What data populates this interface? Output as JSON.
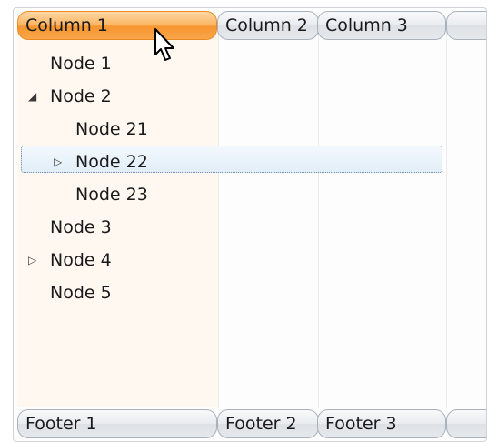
{
  "columns": [
    {
      "label": "Column 1",
      "active": true
    },
    {
      "label": "Column 2"
    },
    {
      "label": "Column 3"
    },
    {
      "label": ""
    }
  ],
  "footers": [
    {
      "label": "Footer 1"
    },
    {
      "label": "Footer 2"
    },
    {
      "label": "Footer 3"
    },
    {
      "label": ""
    }
  ],
  "tree": [
    {
      "label": "Node 1",
      "level": 1,
      "expander": "none"
    },
    {
      "label": "Node 2",
      "level": 1,
      "expander": "expanded"
    },
    {
      "label": "Node 21",
      "level": 2,
      "expander": "none"
    },
    {
      "label": "Node 22",
      "level": 2,
      "expander": "collapsed",
      "selected": true
    },
    {
      "label": "Node 23",
      "level": 2,
      "expander": "none"
    },
    {
      "label": "Node 3",
      "level": 1,
      "expander": "none"
    },
    {
      "label": "Node 4",
      "level": 1,
      "expander": "collapsed"
    },
    {
      "label": "Node 5",
      "level": 1,
      "expander": "none"
    }
  ],
  "icons": {
    "expanded": "collapse-triangle-icon",
    "collapsed": "expand-triangle-icon",
    "cursor": "mouse-pointer-icon"
  },
  "colors": {
    "active_header": "#f7962f",
    "selection_border": "#5b7fa6",
    "column1_tint": "#fff8f1"
  }
}
